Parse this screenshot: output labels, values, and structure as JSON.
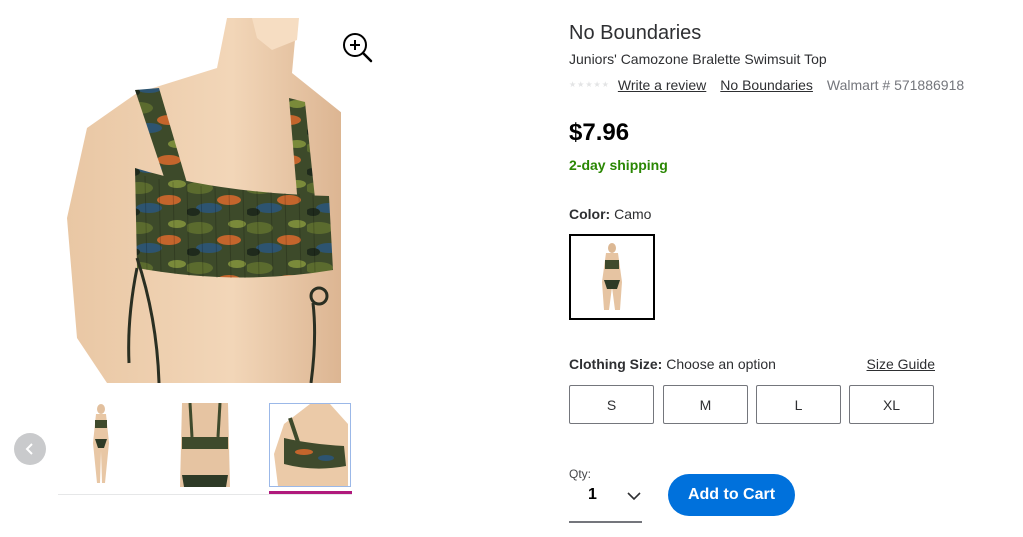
{
  "product": {
    "brand_title": "No Boundaries",
    "name": "Juniors' Camozone Bralette Swimsuit Top",
    "write_review": "Write a review",
    "brand_link": "No Boundaries",
    "walmart_number": "Walmart # 571886918",
    "price": "$7.96",
    "shipping": "2-day shipping",
    "rating_stars": 0,
    "rating_max": 5
  },
  "color": {
    "label": "Color:",
    "value": "Camo"
  },
  "size": {
    "label": "Clothing Size:",
    "value": "Choose an option",
    "guide_label": "Size Guide",
    "options": [
      "S",
      "M",
      "L",
      "XL"
    ]
  },
  "quantity": {
    "label": "Qty:",
    "value": "1"
  },
  "cart": {
    "add_label": "Add to Cart"
  },
  "gallery": {
    "selected_thumb": 3,
    "thumb_count": 3,
    "icons": {
      "zoom": "zoom-in-icon",
      "prev": "chevron-left-icon",
      "qty": "chevron-down-icon"
    }
  },
  "colors": {
    "accent_blue": "#0071dc",
    "shipping_green": "#2a8703",
    "thumb_indicator": "#b0197c"
  }
}
